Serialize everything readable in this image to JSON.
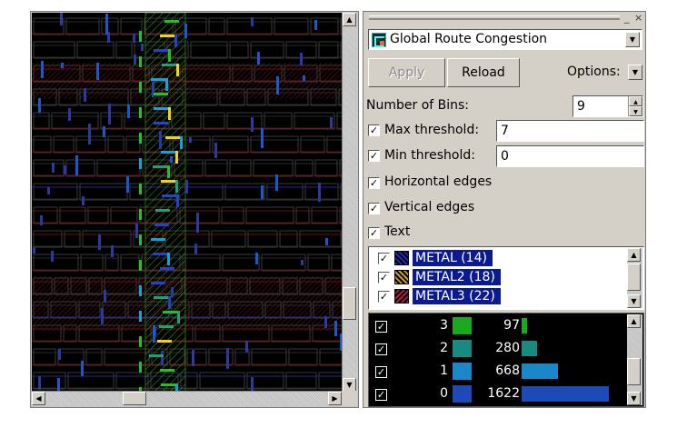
{
  "canvas": {
    "background": "#000000",
    "h_tracks": [
      "#1d2a8a",
      "#6a1010",
      "#2a2a2a"
    ],
    "congestion_colors": [
      "#2244cc",
      "#19a0d8",
      "#1fa07a",
      "#27c020",
      "#f0d020"
    ]
  },
  "panel": {
    "title": "Global Route Congestion",
    "apply_label": "Apply",
    "reload_label": "Reload",
    "options_label": "Options:",
    "bins_label": "Number of Bins:",
    "bins_value": "9",
    "max_label": "Max threshold:",
    "max_value": "7",
    "min_label": "Min threshold:",
    "min_value": "0",
    "horizontal_label": "Horizontal edges",
    "vertical_label": "Vertical edges",
    "text_label": "Text"
  },
  "layers": [
    {
      "name": "METAL (14)",
      "color": "#1c2bb8",
      "checked": true
    },
    {
      "name": "METAL2 (18)",
      "color": "#c8a020",
      "checked": true
    },
    {
      "name": "METAL3 (22)",
      "color": "#b02040",
      "checked": true
    }
  ],
  "histogram": [
    {
      "bin": "3",
      "count": "97",
      "value": 97,
      "color": "#19a81e"
    },
    {
      "bin": "2",
      "count": "280",
      "value": 280,
      "color": "#178a82"
    },
    {
      "bin": "1",
      "count": "668",
      "value": 668,
      "color": "#1a88c8"
    },
    {
      "bin": "0",
      "count": "1622",
      "value": 1622,
      "color": "#1c4bb8"
    }
  ]
}
